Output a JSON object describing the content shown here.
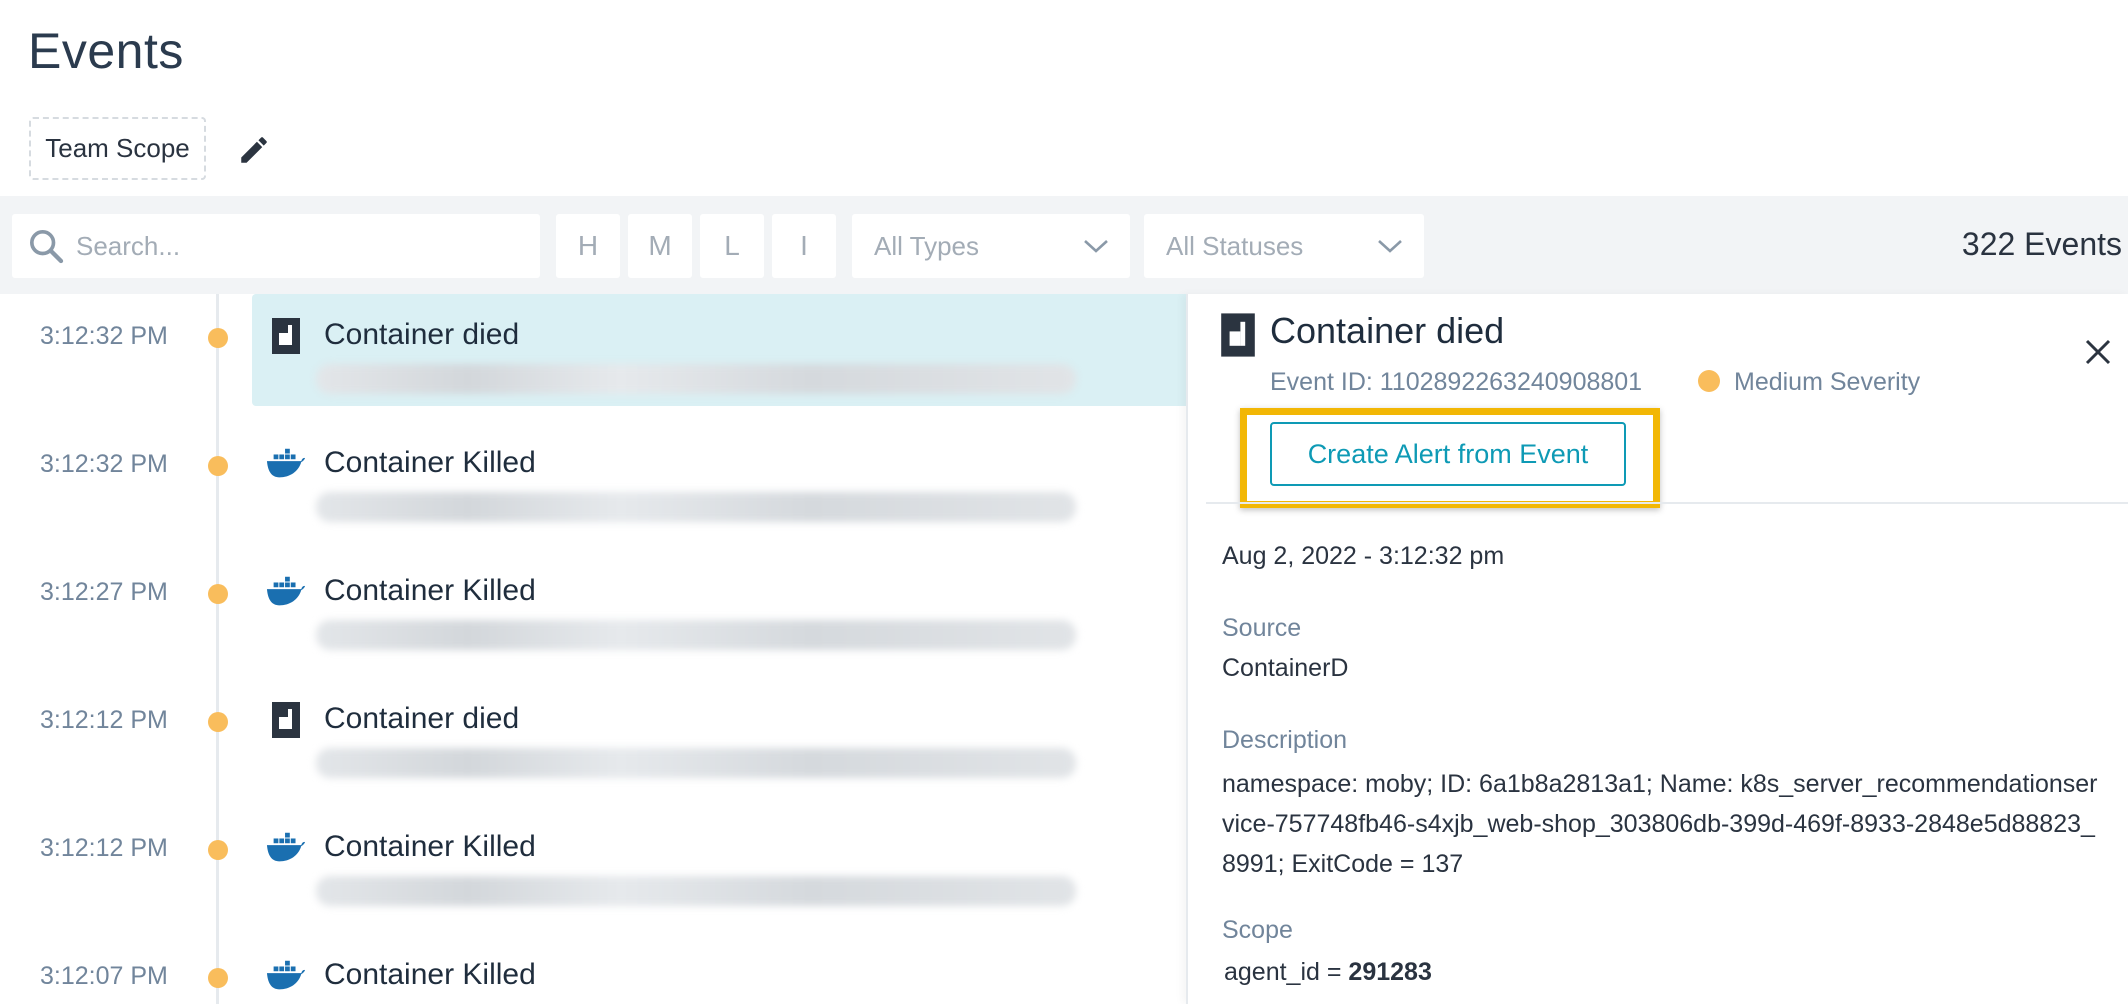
{
  "page": {
    "title": "Events"
  },
  "scope": {
    "label": "Team Scope"
  },
  "filters": {
    "search_placeholder": "Search...",
    "severity_buttons": [
      "H",
      "M",
      "L",
      "I"
    ],
    "type_dropdown": "All Types",
    "status_dropdown": "All Statuses",
    "event_count": "322 Events"
  },
  "events": [
    {
      "time": "3:12:32 PM",
      "name": "Container died",
      "icon": "container-icon",
      "selected": true
    },
    {
      "time": "3:12:32 PM",
      "name": "Container Killed",
      "icon": "docker-icon"
    },
    {
      "time": "3:12:27 PM",
      "name": "Container Killed",
      "icon": "docker-icon"
    },
    {
      "time": "3:12:12 PM",
      "name": "Container died",
      "icon": "container-icon"
    },
    {
      "time": "3:12:12 PM",
      "name": "Container Killed",
      "icon": "docker-icon"
    },
    {
      "time": "3:12:07 PM",
      "name": "Container Killed",
      "icon": "docker-icon"
    }
  ],
  "detail": {
    "title": "Container died",
    "event_id": "Event ID: 110289226324090880​1",
    "severity": "Medium Severity",
    "create_alert_label": "Create Alert from Event",
    "date": "Aug 2, 2022 - 3:12:32 pm",
    "source_label": "Source",
    "source_value": "ContainerD",
    "description_label": "Description",
    "description_value": "namespace: moby; ID: 6a1b8a2813a1; Name: k8s_server_recommendationservice-757748fb46-s4xjb_web-shop_303806db-399d-469f-8933-2848e5d88823_8991; ExitCode = 137",
    "scope_label": "Scope",
    "scope_key": "agent_id = ",
    "scope_value": "291283"
  },
  "colors": {
    "accent": "#0e9ab5",
    "severity_medium": "#f9bd5c",
    "highlight": "#f2b705",
    "selected_row": "#daf0f4"
  }
}
